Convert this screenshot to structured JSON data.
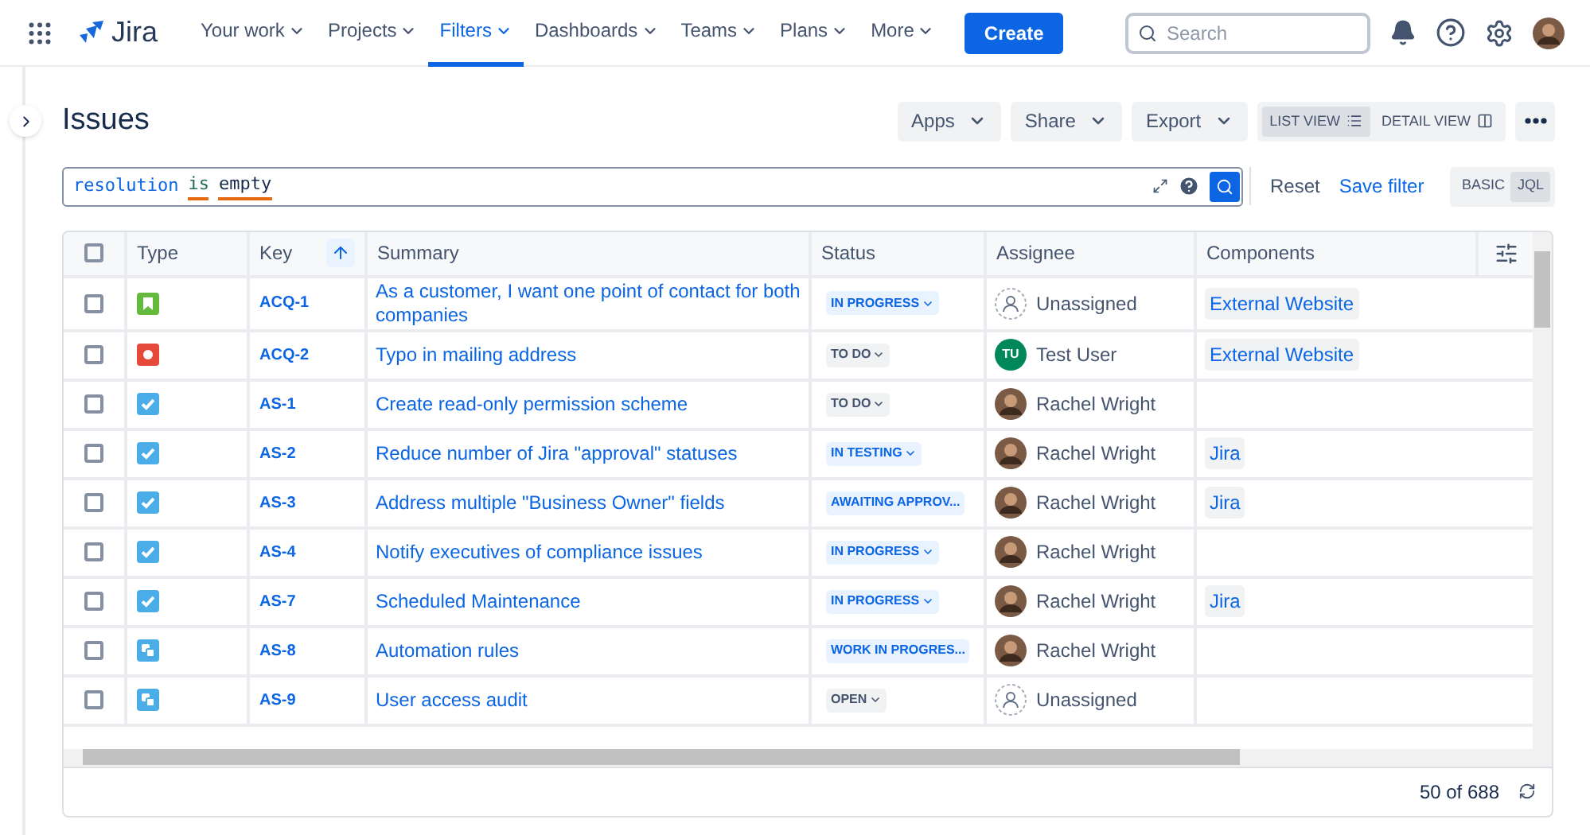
{
  "nav": {
    "product": "Jira",
    "items": [
      {
        "label": "Your work",
        "selected": false
      },
      {
        "label": "Projects",
        "selected": false
      },
      {
        "label": "Filters",
        "selected": true
      },
      {
        "label": "Dashboards",
        "selected": false
      },
      {
        "label": "Teams",
        "selected": false
      },
      {
        "label": "Plans",
        "selected": false
      },
      {
        "label": "More",
        "selected": false
      }
    ],
    "create": "Create",
    "search": {
      "placeholder": "Search"
    }
  },
  "page": {
    "title": "Issues",
    "actions": [
      "Apps",
      "Share",
      "Export"
    ],
    "views": [
      {
        "label": "LIST VIEW",
        "selected": true,
        "kind": "list"
      },
      {
        "label": "DETAIL VIEW",
        "selected": false,
        "kind": "detail"
      }
    ]
  },
  "query": {
    "tokens": [
      {
        "text": "resolution",
        "kind": "field"
      },
      {
        "text": "is",
        "kind": "keyword"
      },
      {
        "text": "empty",
        "kind": "value"
      }
    ],
    "reset": "Reset",
    "save": "Save filter",
    "modes": [
      {
        "label": "BASIC",
        "selected": false
      },
      {
        "label": "JQL",
        "selected": true
      }
    ]
  },
  "table": {
    "select_all_checked": false,
    "columns": [
      "Type",
      "Key",
      "Summary",
      "Status",
      "Assignee",
      "Components"
    ],
    "rows": [
      {
        "checked": false,
        "kind": "story",
        "key": "ACQ-1",
        "summary": "As a customer, I want one point of contact for both companies",
        "status": {
          "text": "IN PROGRESS",
          "kind": "progress"
        },
        "assignee": {
          "name": "Unassigned",
          "kind": "none"
        },
        "components": [
          "External Website"
        ]
      },
      {
        "checked": false,
        "kind": "bug",
        "key": "ACQ-2",
        "summary": "Typo in mailing address",
        "status": {
          "text": "TO DO",
          "kind": "todo"
        },
        "assignee": {
          "name": "Test User",
          "kind": "initials",
          "initials": "TU"
        },
        "components": [
          "External Website"
        ]
      },
      {
        "checked": false,
        "kind": "task",
        "key": "AS-1",
        "summary": "Create read-only permission scheme",
        "status": {
          "text": "TO DO",
          "kind": "todo"
        },
        "assignee": {
          "name": "Rachel Wright",
          "kind": "photo"
        }
      },
      {
        "checked": false,
        "kind": "task",
        "key": "AS-2",
        "summary": "Reduce number of Jira \"approval\" statuses",
        "status": {
          "text": "IN TESTING",
          "kind": "progress"
        },
        "assignee": {
          "name": "Rachel Wright",
          "kind": "photo"
        },
        "components": [
          "Jira"
        ]
      },
      {
        "checked": false,
        "kind": "task",
        "key": "AS-3",
        "summary": "Address multiple \"Business Owner\" fields",
        "status": {
          "text": "AWAITING APPROV...",
          "kind": "progress"
        },
        "assignee": {
          "name": "Rachel Wright",
          "kind": "photo"
        },
        "components": [
          "Jira"
        ]
      },
      {
        "checked": false,
        "kind": "task",
        "key": "AS-4",
        "summary": "Notify executives of compliance issues",
        "status": {
          "text": "IN PROGRESS",
          "kind": "progress"
        },
        "assignee": {
          "name": "Rachel Wright",
          "kind": "photo"
        }
      },
      {
        "checked": false,
        "kind": "task",
        "key": "AS-7",
        "summary": "Scheduled Maintenance",
        "status": {
          "text": "IN PROGRESS",
          "kind": "progress"
        },
        "assignee": {
          "name": "Rachel Wright",
          "kind": "photo"
        },
        "components": [
          "Jira"
        ]
      },
      {
        "checked": false,
        "kind": "subtask",
        "key": "AS-8",
        "summary": "Automation rules",
        "status": {
          "text": "WORK IN PROGRES...",
          "kind": "progress"
        },
        "assignee": {
          "name": "Rachel Wright",
          "kind": "photo"
        }
      },
      {
        "checked": false,
        "kind": "subtask",
        "key": "AS-9",
        "summary": "User access audit",
        "status": {
          "text": "OPEN",
          "kind": "todo"
        },
        "assignee": {
          "name": "Unassigned",
          "kind": "none"
        }
      }
    ],
    "count": "50 of 688"
  }
}
